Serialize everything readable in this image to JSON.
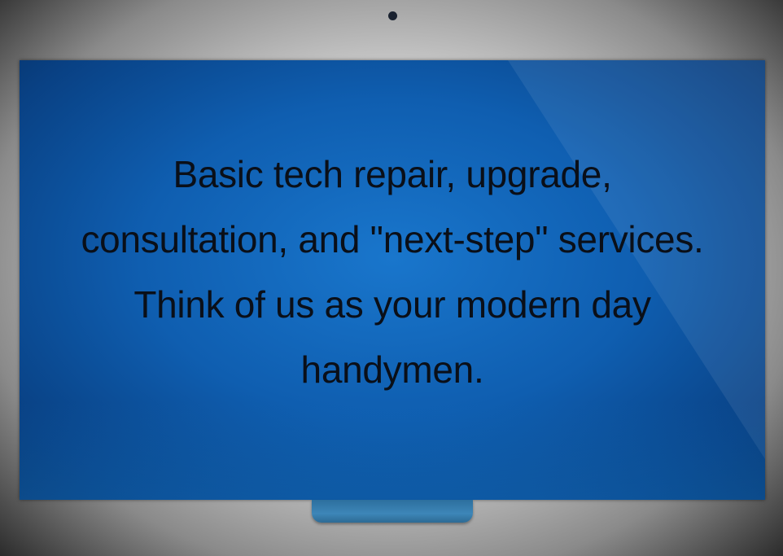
{
  "message": {
    "lines": [
      "Basic tech repair, upgrade,",
      "consultation, and \"next-step\" services.",
      "Think of us as your modern day",
      "handymen."
    ]
  },
  "colors": {
    "screen": "#0f5eb0",
    "text": "#0a0f18",
    "stand": "#3d86b8",
    "frame": "#d8d8d8"
  }
}
